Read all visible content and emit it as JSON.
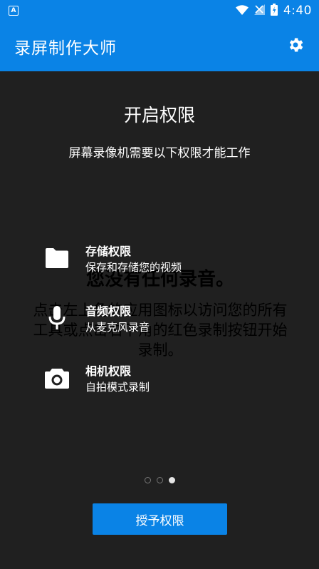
{
  "status_bar": {
    "notification_icon": "app-notification-icon",
    "notification_letter": "A",
    "time": "4:40",
    "icons": [
      "wifi-icon",
      "signal-icon",
      "battery-icon"
    ]
  },
  "app_bar": {
    "title": "录屏制作大师",
    "settings_icon": "gear-icon"
  },
  "empty_state": {
    "title": "您没有任何录音。",
    "description": "点击左上角的应用图标以访问您的所有工具或点击右下角的红色录制按钮开始录制。"
  },
  "permissions": {
    "title": "开启权限",
    "subtitle": "屏幕录像机需要以下权限才能工作",
    "items": [
      {
        "name": "存储权限",
        "desc": "保存和存储您的视频",
        "icon": "folder-icon"
      },
      {
        "name": "音频权限",
        "desc": "从麦克风录音",
        "icon": "microphone-icon"
      },
      {
        "name": "相机权限",
        "desc": "自拍模式录制",
        "icon": "camera-icon"
      }
    ],
    "page_count": 3,
    "active_page": 3,
    "grant_button": "授予权限"
  },
  "colors": {
    "accent": "#0a83e6",
    "background": "#202020"
  }
}
